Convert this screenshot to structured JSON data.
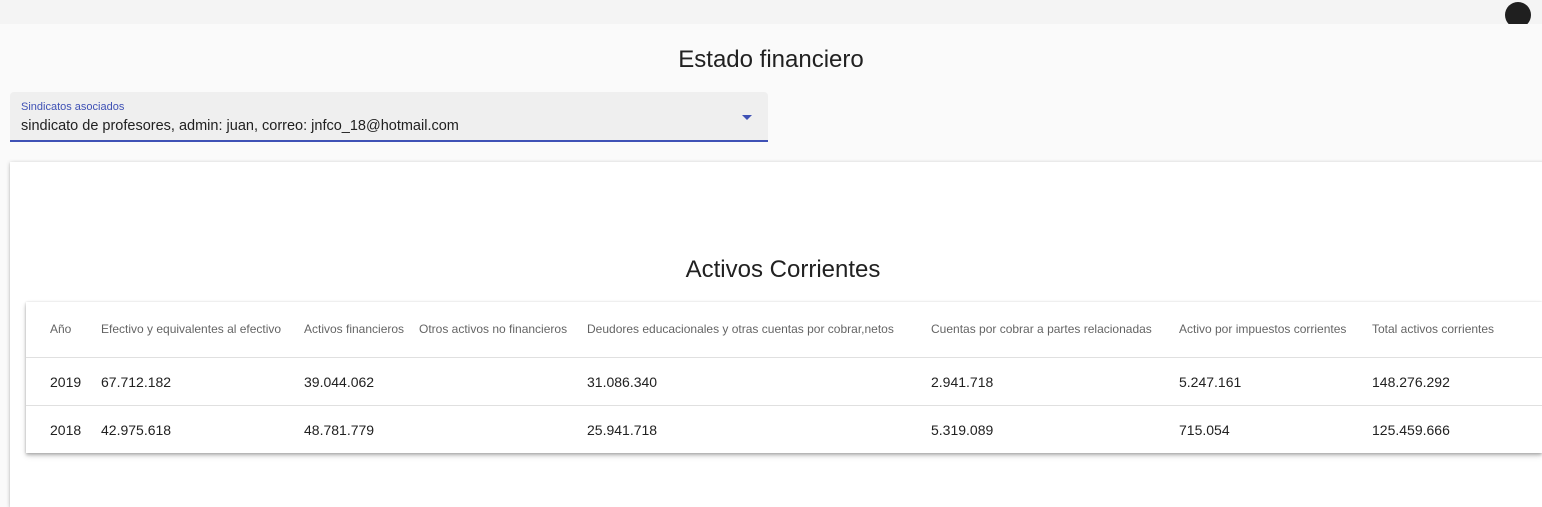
{
  "page": {
    "title": "Estado financiero"
  },
  "select": {
    "label": "Sindicatos asociados",
    "value": "sindicato de profesores, admin: juan, correo: jnfco_18@hotmail.com",
    "accent_color": "#3f51b5"
  },
  "topbar": {
    "account_icon": "account-circle-icon"
  },
  "card": {
    "title": "Activos Corrientes"
  },
  "table": {
    "headers": [
      "Año",
      "Efectivo y equivalentes al efectivo",
      "Activos financieros",
      "Otros activos no financieros",
      "Deudores educacionales y otras cuentas por cobrar,netos",
      "Cuentas por cobrar a partes relacionadas",
      "Activo por impuestos corrientes",
      "Total activos corrientes"
    ],
    "rows": [
      [
        "2019",
        "67.712.182",
        "39.044.062",
        "",
        "31.086.340",
        "2.941.718",
        "5.247.161",
        "148.276.292"
      ],
      [
        "2018",
        "42.975.618",
        "48.781.779",
        "",
        "25.941.718",
        "5.319.089",
        "715.054",
        "125.459.666"
      ]
    ]
  }
}
